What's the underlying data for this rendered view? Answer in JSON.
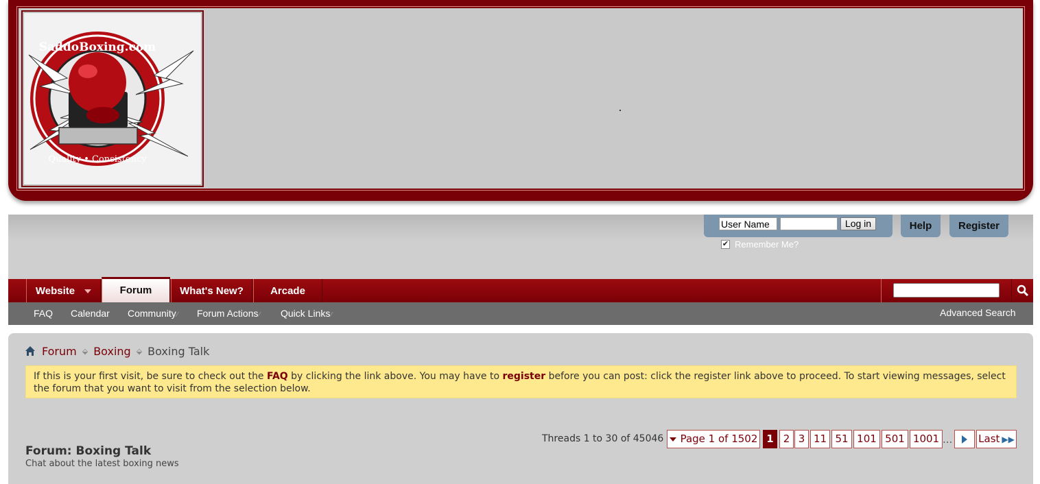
{
  "header": {
    "logo_text_top": "SaddoBoxing.com",
    "logo_text_bottom": "Quality • Consistency"
  },
  "login": {
    "username_value": "User Name",
    "login_button": "Log in",
    "remember_label": "Remember Me?",
    "remember_checked": true,
    "help_button": "Help",
    "register_button": "Register"
  },
  "nav": {
    "tabs": [
      {
        "label": "Website",
        "has_dropdown": true
      },
      {
        "label": "Forum",
        "active": true
      },
      {
        "label": "What's New?"
      },
      {
        "label": "Arcade"
      }
    ]
  },
  "subnav": {
    "items": [
      {
        "label": "FAQ"
      },
      {
        "label": "Calendar"
      },
      {
        "label": "Community"
      },
      {
        "label": "Forum Actions"
      },
      {
        "label": "Quick Links"
      }
    ],
    "advanced_search": "Advanced Search"
  },
  "breadcrumb": {
    "items": [
      "Forum",
      "Boxing"
    ],
    "current": "Boxing Talk"
  },
  "notice": {
    "part1": "If this is your first visit, be sure to check out the ",
    "faq": "FAQ",
    "part2": " by clicking the link above. You may have to ",
    "register": "register",
    "part3": " before you can post: click the register link above to proceed. To start viewing messages, select the forum that you want to visit from the selection below."
  },
  "threads": {
    "count_text": "Threads 1 to 30 of 45046",
    "page_label": "Page 1 of 1502",
    "pages": [
      "1",
      "2",
      "3",
      "11",
      "51",
      "101",
      "501",
      "1001"
    ],
    "current_page": "1",
    "ellipsis": "...",
    "last_label": "Last"
  },
  "forum": {
    "title": "Forum: Boxing Talk",
    "description": "Chat about the latest boxing news"
  },
  "colors": {
    "brand": "#7a0008",
    "nav_bg": "#8b050b",
    "subnav_bg": "#6c6c6c",
    "login_bg": "#7b96ad",
    "notice_bg": "#fee98f"
  }
}
